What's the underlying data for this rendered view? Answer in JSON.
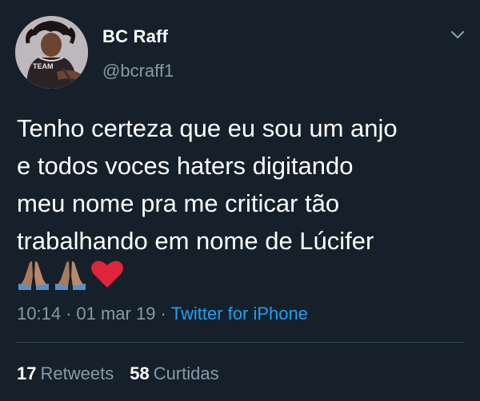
{
  "author": {
    "name": "BC Raff",
    "handle": "@bcraff1",
    "avatar_shirt_text": "TEAM"
  },
  "tweet": {
    "lines": [
      "Tenho certeza que eu sou um anjo",
      "e todos voces haters digitando",
      "meu nome pra me criticar tão",
      "trabalhando em nome de Lúcifer"
    ],
    "emojis": [
      "folded-hands",
      "folded-hands",
      "red-heart"
    ]
  },
  "meta": {
    "time": "10:14",
    "date": "01 mar 19",
    "separator": "·",
    "source": "Twitter for iPhone"
  },
  "stats": {
    "retweets_count": "17",
    "retweets_label": "Retweets",
    "likes_count": "58",
    "likes_label": "Curtidas"
  },
  "colors": {
    "background": "#15202b",
    "text": "#ffffff",
    "muted": "#8899a6",
    "link": "#1da1f2",
    "divider": "#38444d"
  },
  "icons": {
    "menu": "chevron-down-icon"
  }
}
